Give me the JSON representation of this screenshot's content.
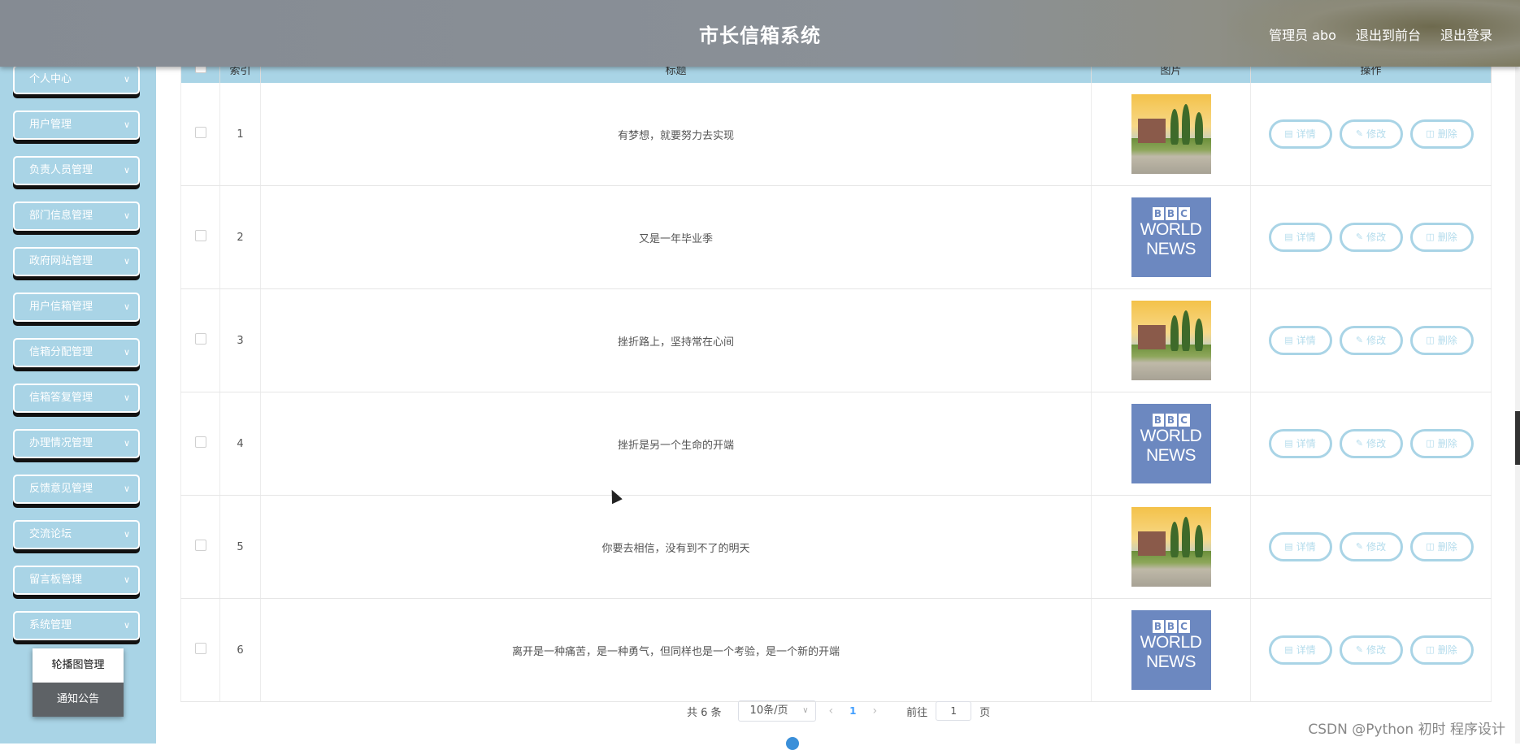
{
  "header": {
    "title": "市长信箱系统",
    "user_label": "管理员 abo",
    "to_front": "退出到前台",
    "logout": "退出登录"
  },
  "sidebar": {
    "items": [
      {
        "label": "个人中心"
      },
      {
        "label": "用户管理"
      },
      {
        "label": "负责人员管理"
      },
      {
        "label": "部门信息管理"
      },
      {
        "label": "政府网站管理"
      },
      {
        "label": "用户信箱管理"
      },
      {
        "label": "信箱分配管理"
      },
      {
        "label": "信箱答复管理"
      },
      {
        "label": "办理情况管理"
      },
      {
        "label": "反馈意见管理"
      },
      {
        "label": "交流论坛"
      },
      {
        "label": "留言板管理"
      },
      {
        "label": "系统管理"
      }
    ],
    "submenu": [
      {
        "label": "轮播图管理"
      },
      {
        "label": "通知公告"
      }
    ]
  },
  "table": {
    "headers": [
      "",
      "索引",
      "标题",
      "图片",
      "操作"
    ],
    "rows": [
      {
        "index": "1",
        "title": "有梦想，就要努力去实现",
        "image": "campus"
      },
      {
        "index": "2",
        "title": "又是一年毕业季",
        "image": "bbc"
      },
      {
        "index": "3",
        "title": "挫折路上，坚持常在心间",
        "image": "campus"
      },
      {
        "index": "4",
        "title": "挫折是另一个生命的开端",
        "image": "bbc"
      },
      {
        "index": "5",
        "title": "你要去相信，没有到不了的明天",
        "image": "campus"
      },
      {
        "index": "6",
        "title": "离开是一种痛苦，是一种勇气，但同样也是一个考验，是一个新的开端",
        "image": "bbc"
      }
    ],
    "actions": {
      "detail": "详情",
      "edit": "修改",
      "delete": "删除"
    },
    "bbc_text": {
      "logo": [
        "B",
        "B",
        "C"
      ],
      "line1": "WORLD",
      "line2": "NEWS"
    }
  },
  "pagination": {
    "total": "共 6 条",
    "page_size": "10条/页",
    "current_page": "1",
    "goto_label": "前往",
    "goto_value": "1",
    "page_suffix": "页"
  },
  "watermark": "CSDN @Python 初时 程序设计",
  "colors": {
    "accent": "#a9d4e6",
    "header": "#858b93"
  }
}
